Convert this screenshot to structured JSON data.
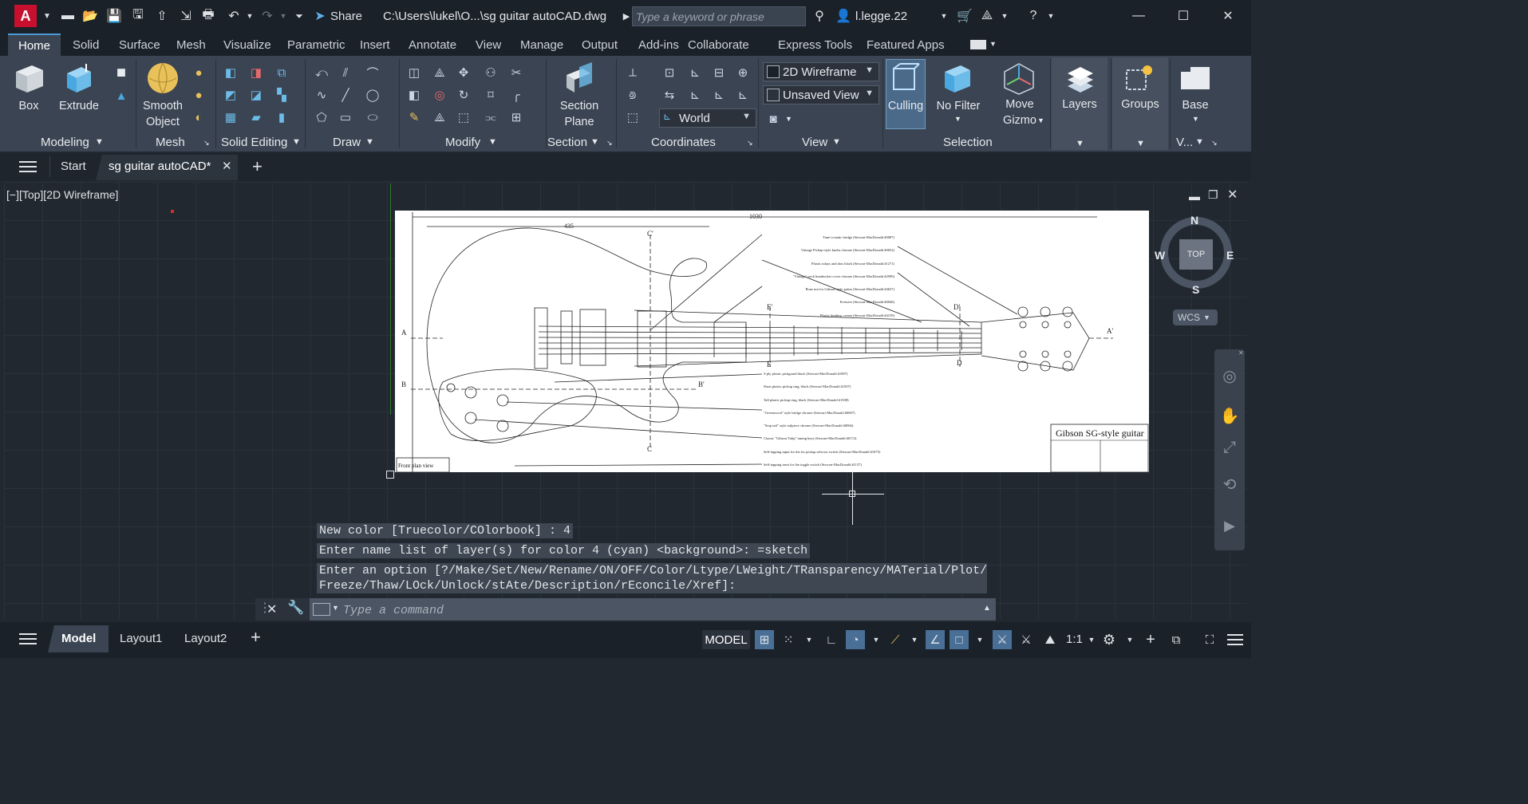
{
  "titlebar": {
    "share_label": "Share",
    "file_path": "C:\\Users\\lukel\\O...\\sg guitar autoCAD.dwg",
    "search_placeholder": "Type a keyword or phrase",
    "user": "l.legge.22"
  },
  "ribbon_tabs": [
    "Home",
    "Solid",
    "Surface",
    "Mesh",
    "Visualize",
    "Parametric",
    "Insert",
    "Annotate",
    "View",
    "Manage",
    "Output",
    "Add-ins",
    "Collaborate",
    "Express Tools",
    "Featured Apps"
  ],
  "ribbon": {
    "box": "Box",
    "extrude": "Extrude",
    "smooth_object_1": "Smooth",
    "smooth_object_2": "Object",
    "section_plane_1": "Section",
    "section_plane_2": "Plane",
    "visual_style": "2D Wireframe",
    "named_view": "Unsaved View",
    "ucs": "World",
    "culling": "Culling",
    "no_filter": "No Filter",
    "move_gizmo_1": "Move",
    "move_gizmo_2": "Gizmo",
    "layers": "Layers",
    "groups": "Groups",
    "base": "Base",
    "groups_row": [
      "Modeling",
      "Mesh",
      "Solid Editing",
      "Draw",
      "Modify",
      "Section",
      "Coordinates",
      "View",
      "Selection",
      "V..."
    ]
  },
  "file_tabs": {
    "start": "Start",
    "active": "sg guitar autoCAD*"
  },
  "viewport": {
    "label": "[−][Top][2D Wireframe]",
    "viewcube": {
      "n": "N",
      "s": "S",
      "e": "E",
      "w": "W",
      "top": "TOP",
      "wcs": "WCS"
    }
  },
  "drawing": {
    "title": "Gibson SG-style guitar",
    "overall_dim": "1030",
    "dim_left": "435",
    "plan_view": "Front plan view",
    "section_marks": [
      "A",
      "A'",
      "B",
      "B'",
      "C",
      "C'",
      "D",
      "D'",
      "E",
      "E'"
    ],
    "callouts_upper": [
      "Tune-o-matic bridge (Stewart-MacDonald #0087)",
      "Vintage Pickup-style knobs chrome (Stewart-MacDonald #0052)",
      "Plastic inlays and dots black (Stewart-MacDonald #1271)",
      "\"Vintage\" neck humbucker cover chrome (Stewart-MacDonald #2990)",
      "Bone nut for Gibson-style guitar (Stewart-MacDonald #4637)",
      "Fretwire (Stewart-MacDonald #0046)",
      "Plastic binding, cream (Stewart-MacDonald #4159)"
    ],
    "callouts_lower": [
      "3-ply plastic pickguard black (Stewart-MacDonald #1087)",
      "Short plastic pickup ring, black (Stewart-MacDonald #1507)",
      "Tall plastic pickup ring, black (Stewart-MacDonald #1508)",
      "\"Greenwood\" style bridge chrome (Stewart-MacDonald #0067)",
      "\"Stop tail\" style tailpiece chrome (Stewart-MacDonald #0066)",
      "Classic \"Gibson Tulip\" tuning keys (Stewart-MacDonald #0172)",
      "Self-tapping input for the for pickup selector switch (Stewart-MacDonald #1075)",
      "Self-tapping inset for the toggle switch (Stewart-MacDonald #1157)"
    ]
  },
  "command_history": [
    "New color [Truecolor/COlorbook] : 4",
    "Enter name list of layer(s) for color 4 (cyan) <background>: =sketch",
    "Enter an option [?/Make/Set/New/Rename/ON/OFF/Color/Ltype/LWeight/TRansparency/MATerial/Plot/",
    "Freeze/Thaw/LOck/Unlock/stAte/Description/rEconcile/Xref]:"
  ],
  "command_placeholder": "Type a command",
  "status": {
    "tabs": [
      "Model",
      "Layout1",
      "Layout2"
    ],
    "model_label": "MODEL",
    "scale": "1:1"
  }
}
